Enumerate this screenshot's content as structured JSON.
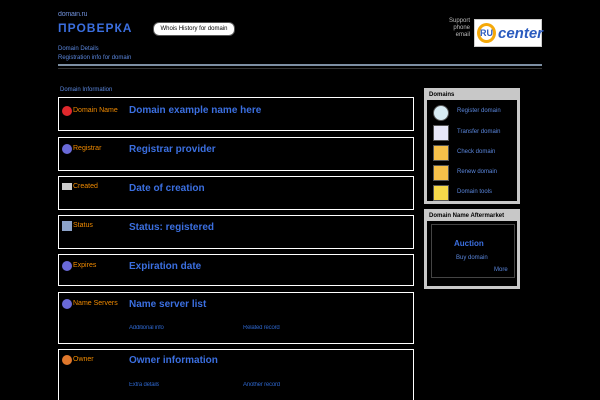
{
  "header": {
    "small_title": "domain.ru",
    "big_title": "ПРОВЕРКА",
    "whois_button": "Whois History for domain",
    "sub_line1": "Domain Details",
    "sub_line2": "Registration info for domain"
  },
  "contact": {
    "line1": "Support",
    "line2": "phone",
    "line3": "email"
  },
  "logo": {
    "ring": "RU",
    "text": "center"
  },
  "section_title": "Domain Information",
  "rows": [
    {
      "label": "Domain Name",
      "value": "Domain example name here",
      "icon_color": "#e0282c"
    },
    {
      "label": "Registrar",
      "value": "Registrar provider",
      "icon_color": "#6a6ad8"
    },
    {
      "label": "Created",
      "value": "Date of creation",
      "icon_color": "#cccccc"
    },
    {
      "label": "Status",
      "value": "Status: registered",
      "icon_color": "#8ca2c8"
    },
    {
      "label": "Expires",
      "value": "Expiration date",
      "icon_color": "#6a6ad8"
    },
    {
      "label": "Name Servers",
      "value": "Name server list",
      "icon_color": "#6a6ad8"
    },
    {
      "label": "Owner",
      "value": "Owner information",
      "icon_color": "#e0782c"
    }
  ],
  "row_extras": [
    {
      "left": "Additional info",
      "right": "Related record"
    },
    {
      "left": "Extra details",
      "right": "Another record"
    }
  ],
  "side_panel": {
    "title": "Domains",
    "items": [
      {
        "label": "Register domain",
        "icon": "globe-icon"
      },
      {
        "label": "Transfer domain",
        "icon": "ru-icon"
      },
      {
        "label": "Check domain",
        "icon": "folder-icon"
      },
      {
        "label": "Renew domain",
        "icon": "folder-icon"
      },
      {
        "label": "Domain tools",
        "icon": "folder-icon"
      }
    ]
  },
  "aftermarket": {
    "title": "Domain Name Aftermarket",
    "line1": "Auction",
    "line2": "Buy domain",
    "link": "More"
  },
  "colors": {
    "accent": "#3b6fe0",
    "label": "#f08a00",
    "panel_border": "#c8c8c8"
  }
}
